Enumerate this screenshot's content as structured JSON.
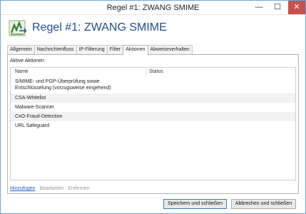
{
  "window": {
    "title": "Regel #1: ZWANG SMIME",
    "controls": {
      "minimize": "—",
      "maximize": "☐",
      "close": "✕"
    }
  },
  "header": {
    "title": "Regel #1: ZWANG SMIME",
    "logo_icon": "rule-logo-icon"
  },
  "tabs": [
    {
      "label": "Allgemein"
    },
    {
      "label": "Nachrichtenfluss"
    },
    {
      "label": "IP-Filterung"
    },
    {
      "label": "Filter"
    },
    {
      "label": "Aktionen",
      "active": true
    },
    {
      "label": "Abweiseverhalten"
    }
  ],
  "panel": {
    "section_label": "Aktive Aktionen",
    "columns": {
      "name": "Name",
      "status": "Status"
    },
    "rows": [
      {
        "line1": "S/MIME- und PGP-Überprüfung sowie",
        "line2": "Entschlüsselung (vorzugsweise eingehend)",
        "status": ""
      },
      {
        "name": "CSA-Whitelist",
        "status": ""
      },
      {
        "name": "Malware-Scanner",
        "status": ""
      },
      {
        "name": "CxO-Fraud-Detection",
        "status": ""
      },
      {
        "name": "URL Safeguard",
        "status": ""
      }
    ],
    "actions": {
      "add": "Hinzufügen",
      "edit": "Bearbeiten",
      "remove": "Entfernen"
    }
  },
  "buttons": {
    "save": "Speichern und schließen",
    "cancel": "Abbrechen und schließen"
  },
  "colors": {
    "accent": "#1f4e8c",
    "link": "#1f5fbf",
    "close": "#c75050"
  }
}
